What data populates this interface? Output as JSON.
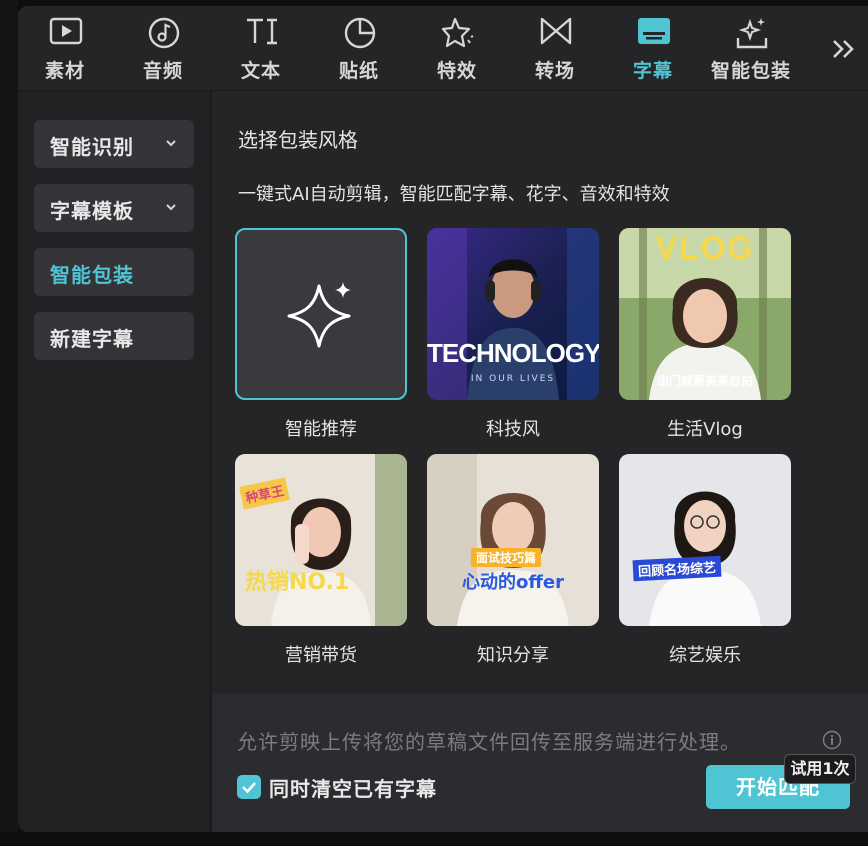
{
  "tabs": [
    {
      "label": "素材",
      "icon": "media-play-icon",
      "active": false
    },
    {
      "label": "音频",
      "icon": "music-note-icon",
      "active": false
    },
    {
      "label": "文本",
      "icon": "text-ti-icon",
      "active": false
    },
    {
      "label": "贴纸",
      "icon": "sticker-icon",
      "active": false
    },
    {
      "label": "特效",
      "icon": "effects-star-icon",
      "active": false
    },
    {
      "label": "转场",
      "icon": "transition-icon",
      "active": false
    },
    {
      "label": "字幕",
      "icon": "subtitle-icon",
      "active": true
    },
    {
      "label": "智能包装",
      "icon": "smart-pack-icon",
      "active": false
    }
  ],
  "sidebar": {
    "items": [
      {
        "label": "智能识别",
        "has_chevron": true,
        "active": false
      },
      {
        "label": "字幕模板",
        "has_chevron": true,
        "active": false
      },
      {
        "label": "智能包装",
        "has_chevron": false,
        "active": true
      },
      {
        "label": "新建字幕",
        "has_chevron": false,
        "active": false
      }
    ]
  },
  "content": {
    "title": "选择包装风格",
    "subtitle": "一键式AI自动剪辑，智能匹配字幕、花字、音效和特效",
    "styles": [
      {
        "label": "智能推荐",
        "selected": true
      },
      {
        "label": "科技风",
        "overlay": "TECHNOLOGY",
        "overlay_sub": "IN OUR LIVES"
      },
      {
        "label": "生活Vlog",
        "overlay": "VLOG",
        "caption": "出门就要美美自拍"
      },
      {
        "label": "营销带货",
        "overlay": "热销NO.1",
        "badge": "种草王"
      },
      {
        "label": "知识分享",
        "overlay": "心动的offer",
        "badge": "面试技巧篇"
      },
      {
        "label": "综艺娱乐",
        "badge": "回顾名场综艺"
      }
    ]
  },
  "footer": {
    "notice": "允许剪映上传将您的草稿文件回传至服务端进行处理。",
    "checkbox_label": "同时清空已有字幕",
    "checkbox_checked": true,
    "start_button": "开始匹配",
    "trial_badge": "试用1次"
  },
  "colors": {
    "accent": "#4fc4d3",
    "panel": "#252528",
    "sidebar_item": "#343438"
  }
}
